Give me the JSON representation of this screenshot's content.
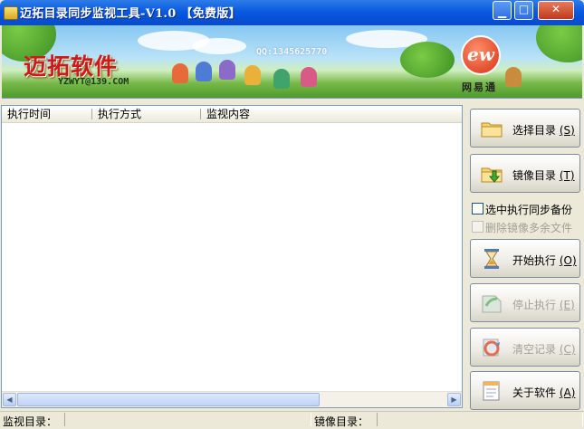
{
  "window": {
    "title": "迈拓目录同步监视工具-V1.0 【免费版】",
    "controls": {
      "minimize": "minimize-icon",
      "maximize": "maximize-icon",
      "close": "close-icon"
    }
  },
  "banner": {
    "brand_name": "迈拓软件",
    "brand_email": "YZWYT@139.COM",
    "qq": "QQ:1345625770",
    "partner_logo": "ew",
    "partner_name": "网易通"
  },
  "list": {
    "columns": [
      "执行时间",
      "执行方式",
      "监视内容"
    ],
    "rows": []
  },
  "buttons": {
    "select_dir": {
      "text": "选择目录",
      "hotkey": "(S)",
      "icon": "folder-icon"
    },
    "mirror_dir": {
      "text": "镜像目录",
      "hotkey": "(T)",
      "icon": "folder-arrow-icon"
    },
    "start": {
      "text": "开始执行",
      "hotkey": "(O)",
      "icon": "hourglass-icon"
    },
    "stop": {
      "text": "停止执行",
      "hotkey": "(E)",
      "icon": "stop-icon"
    },
    "clear": {
      "text": "清空记录",
      "hotkey": "(C)",
      "icon": "clear-icon"
    },
    "about": {
      "text": "关于软件",
      "hotkey": "(A)",
      "icon": "notepad-icon"
    }
  },
  "options": {
    "sync_backup": {
      "label": "选中执行同步备份",
      "checked": false,
      "enabled": true
    },
    "delete_extra": {
      "label": "删除镜像多余文件",
      "checked": false,
      "enabled": false
    }
  },
  "status": {
    "monitor_label": "监视目录：",
    "monitor_value": "",
    "mirror_label": "镜像目录：",
    "mirror_value": ""
  }
}
